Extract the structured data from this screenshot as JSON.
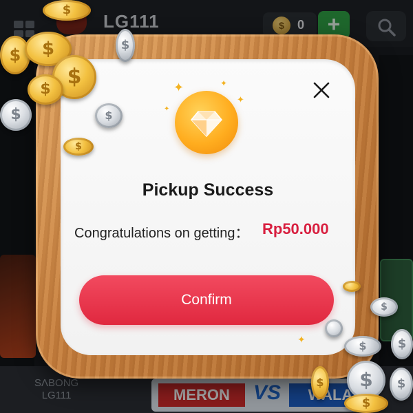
{
  "background_app": {
    "brand": "LG111",
    "balance": "0",
    "add_symbol": "+",
    "bottom_logo_top": "SΛBONG",
    "bottom_logo_bottom": "LG111",
    "match_left": "MERON",
    "match_vs": "VS",
    "match_right": "WALA"
  },
  "dialog": {
    "title": "Pickup Success",
    "message": "Congratulations on getting：",
    "amount": "Rp50.000",
    "confirm_label": "Confirm",
    "close_symbol": "✕",
    "badge_icon": "diamond-icon"
  },
  "colors": {
    "accent_red": "#e0283f",
    "amount_red": "#d81f3f",
    "badge_gold": "#ffad1f",
    "wood_frame": "#c7803f"
  }
}
